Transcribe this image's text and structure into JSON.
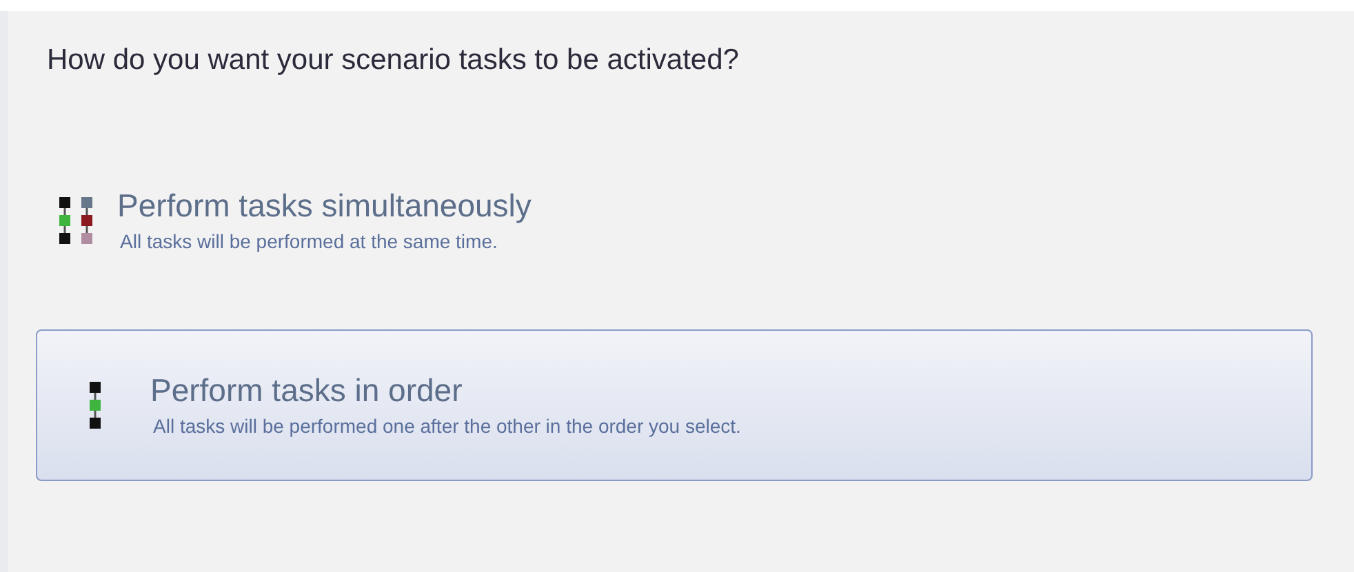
{
  "heading": "How do you want your scenario tasks to be activated?",
  "options": [
    {
      "kind": "parallel",
      "title": "Perform tasks simultaneously",
      "description": "All tasks will be performed at the same time.",
      "selected": false
    },
    {
      "kind": "sequential",
      "title": "Perform tasks in order",
      "description": "All tasks will be performed one after the other in the order you select.",
      "selected": true
    }
  ]
}
